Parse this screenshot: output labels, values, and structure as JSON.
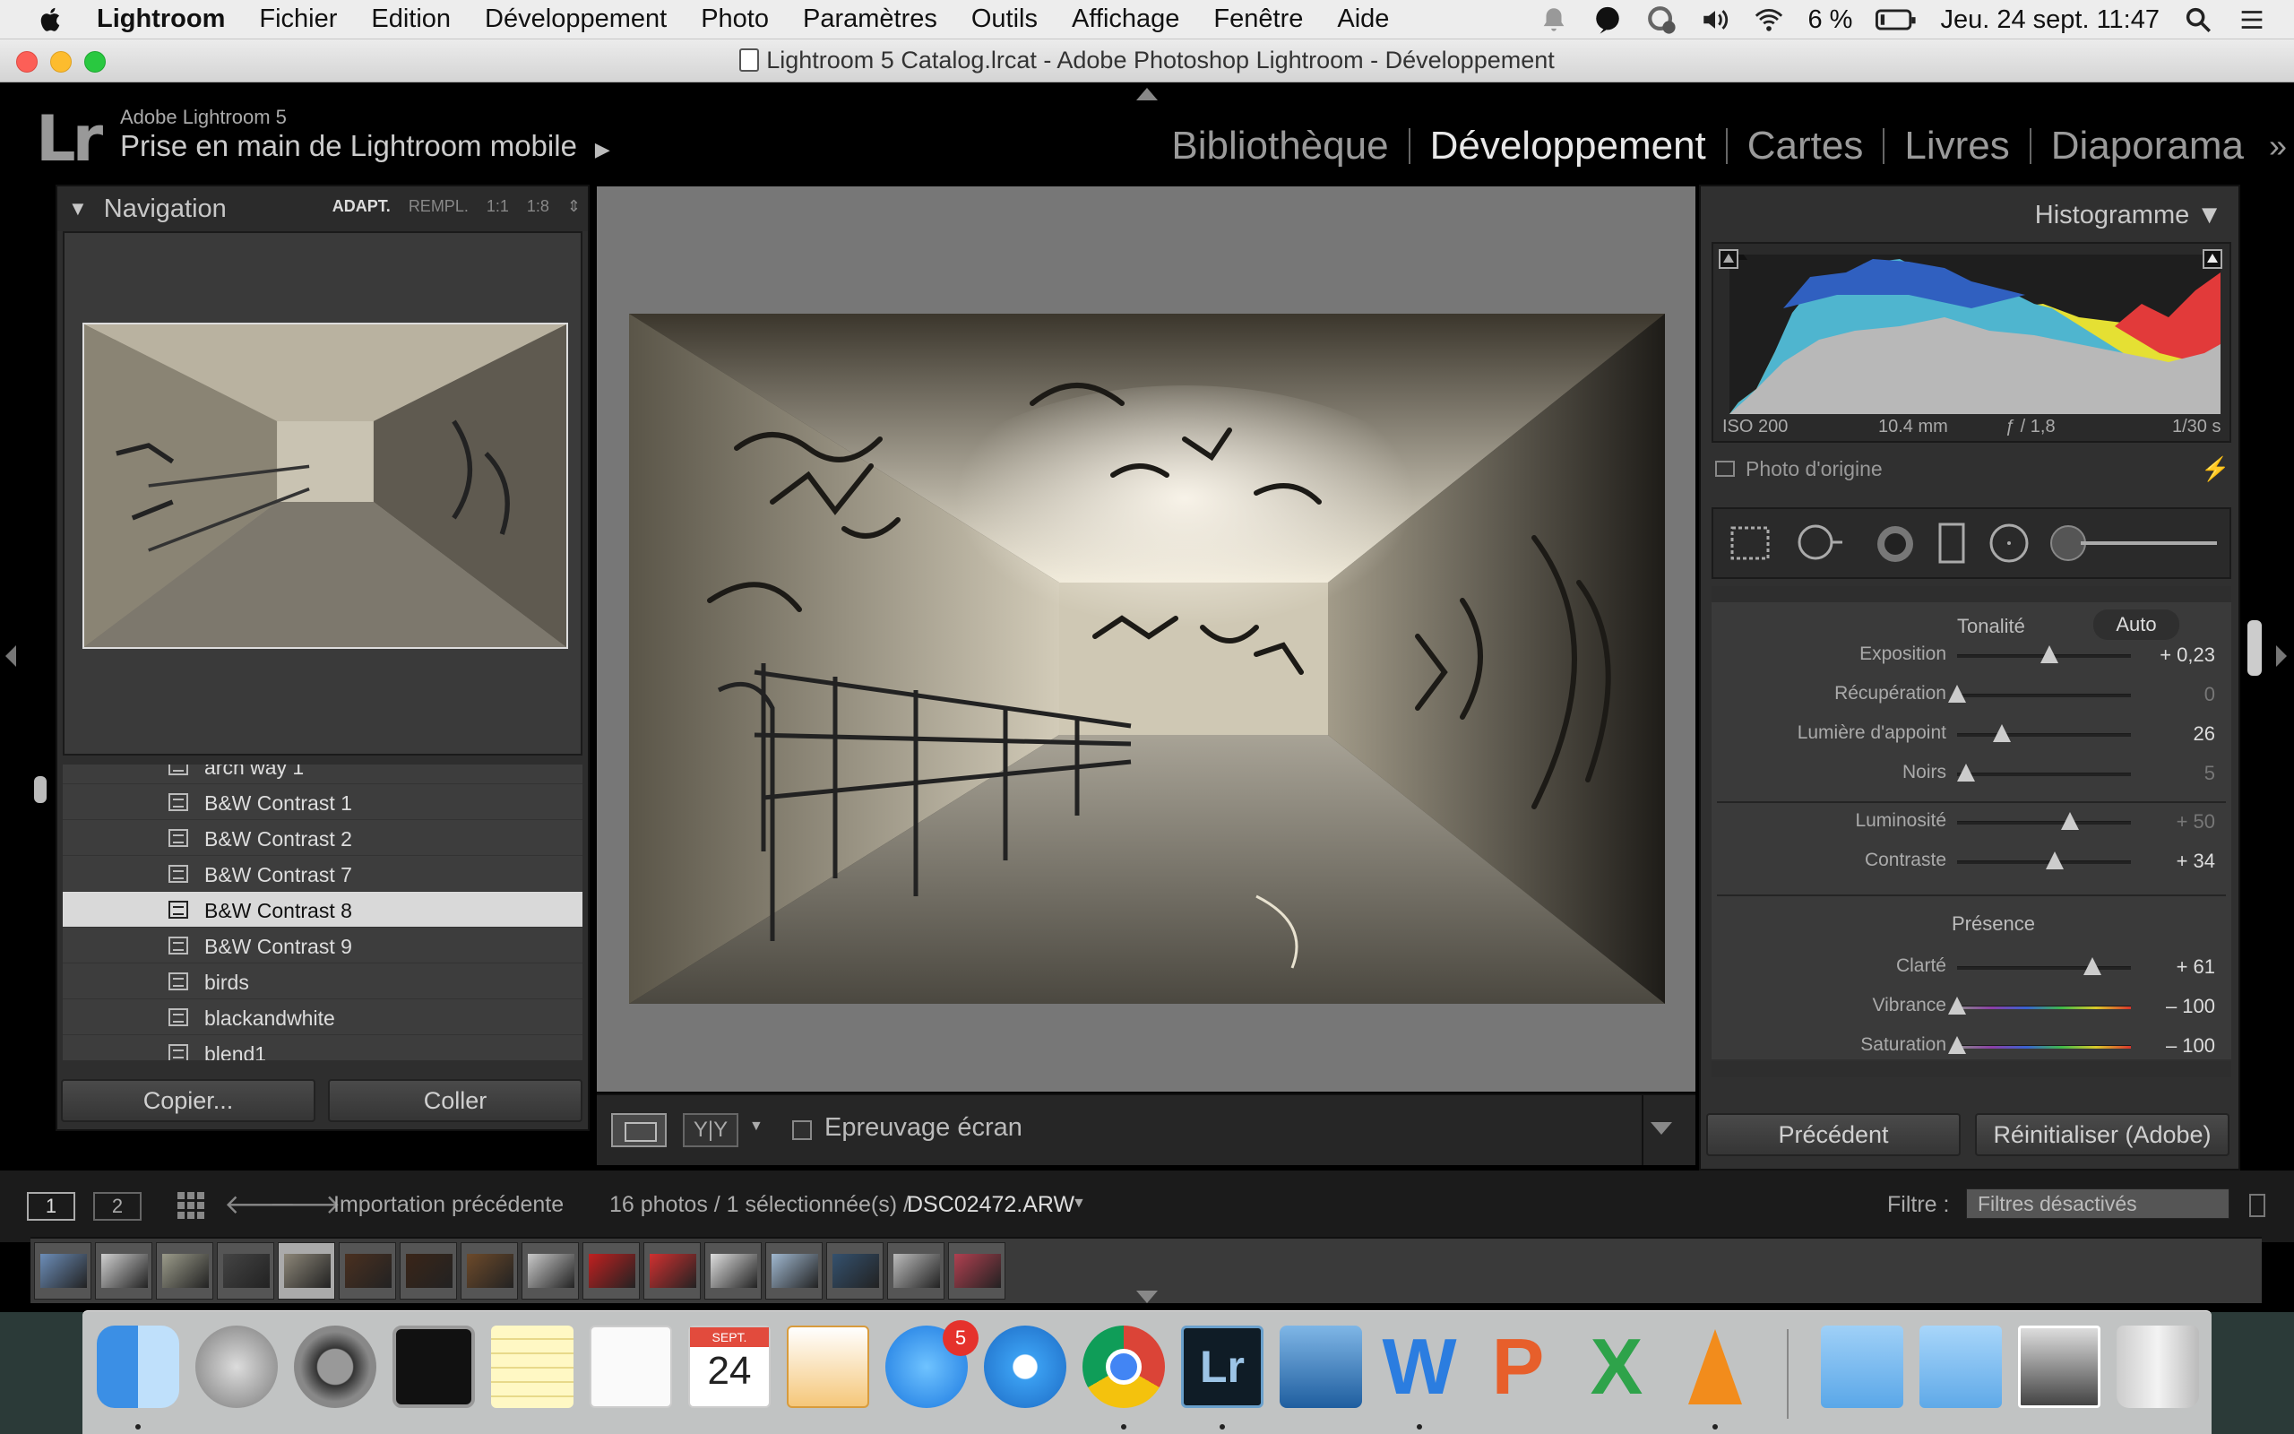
{
  "menubar": {
    "app_name": "Lightroom",
    "items": [
      "Fichier",
      "Edition",
      "Développement",
      "Photo",
      "Paramètres",
      "Outils",
      "Affichage",
      "Fenêtre",
      "Aide"
    ],
    "battery": "6 %",
    "datetime": "Jeu. 24 sept.  11:47"
  },
  "window": {
    "title": "Lightroom 5 Catalog.lrcat - Adobe Photoshop Lightroom - Développement"
  },
  "header": {
    "logo": "Lr",
    "version": "Adobe Lightroom 5",
    "identity": "Prise en main de Lightroom mobile",
    "modules": [
      {
        "label": "Bibliothèque",
        "active": false
      },
      {
        "label": "Développement",
        "active": true
      },
      {
        "label": "Cartes",
        "active": false
      },
      {
        "label": "Livres",
        "active": false
      },
      {
        "label": "Diaporama",
        "active": false
      }
    ]
  },
  "navigator": {
    "title": "Navigation",
    "zooms": [
      "ADAPT.",
      "REMPL.",
      "1:1",
      "1:8"
    ]
  },
  "presets": [
    {
      "label": "arch way 1",
      "selected": false
    },
    {
      "label": "B&W Contrast 1",
      "selected": false
    },
    {
      "label": "B&W Contrast 2",
      "selected": false
    },
    {
      "label": "B&W Contrast 7",
      "selected": false
    },
    {
      "label": "B&W Contrast 8",
      "selected": true
    },
    {
      "label": "B&W Contrast 9",
      "selected": false
    },
    {
      "label": "birds",
      "selected": false
    },
    {
      "label": "blackandwhite",
      "selected": false
    },
    {
      "label": "blend1",
      "selected": false
    }
  ],
  "left_buttons": {
    "copy": "Copier...",
    "paste": "Coller"
  },
  "toolbar": {
    "yy": "Y|Y",
    "proof": "Epreuvage écran"
  },
  "histogram": {
    "title": "Histogramme",
    "iso": "ISO 200",
    "focal": "10.4 mm",
    "aperture": "ƒ / 1,8",
    "shutter": "1/30 s",
    "original": "Photo d'origine"
  },
  "basic": {
    "tone_title": "Tonalité",
    "auto": "Auto",
    "tone": [
      {
        "label": "Exposition",
        "value": "+ 0,23",
        "pos": 0.53,
        "dim": false
      },
      {
        "label": "Récupération",
        "value": "0",
        "pos": 0.0,
        "dim": true
      },
      {
        "label": "Lumière d'appoint",
        "value": "26",
        "pos": 0.26,
        "dim": false
      },
      {
        "label": "Noirs",
        "value": "5",
        "pos": 0.05,
        "dim": true
      }
    ],
    "tone2": [
      {
        "label": "Luminosité",
        "value": "+ 50",
        "pos": 0.65,
        "dim": true
      },
      {
        "label": "Contraste",
        "value": "+ 34",
        "pos": 0.56,
        "dim": false
      }
    ],
    "presence_title": "Présence",
    "presence": [
      {
        "label": "Clarté",
        "value": "+ 61",
        "pos": 0.78,
        "dim": false
      },
      {
        "label": "Vibrance",
        "value": "– 100",
        "pos": 0.0,
        "dim": false
      },
      {
        "label": "Saturation",
        "value": "– 100",
        "pos": 0.0,
        "dim": false
      }
    ]
  },
  "right_buttons": {
    "previous": "Précédent",
    "reset": "Réinitialiser (Adobe)"
  },
  "status": {
    "screen1": "1",
    "screen2": "2",
    "source": "Importation précédente",
    "count": "16 photos / 1 sélectionnée(s) /",
    "filename": "DSC02472.ARW",
    "filter_label": "Filtre :",
    "filter_value": "Filtres désactivés"
  },
  "filmstrip_count": 16,
  "filmstrip_selected": 4,
  "dock": {
    "calendar_month": "SEPT.",
    "calendar_day": "24",
    "appstore_badge": "5",
    "apps": [
      "finder",
      "launchpad",
      "system-preferences",
      "activity-monitor",
      "notes",
      "reminders",
      "calendar",
      "pages",
      "app-store",
      "safari",
      "chrome",
      "lightroom",
      "virtualbox",
      "word",
      "powerpoint",
      "excel",
      "vlc",
      "applications-folder",
      "downloads-folder",
      "photos-stack",
      "trash"
    ]
  }
}
